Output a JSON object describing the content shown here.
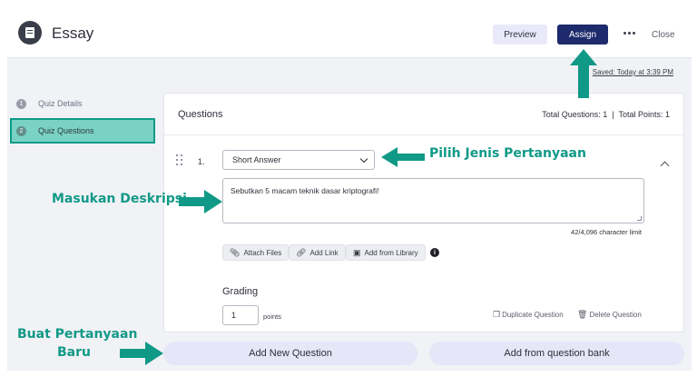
{
  "header": {
    "title": "Essay",
    "preview_label": "Preview",
    "assign_label": "Assign",
    "close_label": "Close",
    "saved_text": "Saved: Today at 3:39 PM"
  },
  "sidebar": {
    "items": [
      {
        "num": "1",
        "label": "Quiz Details",
        "active": false
      },
      {
        "num": "2",
        "label": "Quiz Questions",
        "active": true
      }
    ]
  },
  "questions": {
    "title": "Questions",
    "stats": "Total Questions: 1  |  Total Points: 1",
    "question_number": "1.",
    "type_selected": "Short Answer",
    "description": "Sebutkan 5 macam teknik dasar kriptografi!",
    "char_limit": "42/4,096 character limit",
    "attach_files": "Attach Files",
    "add_link": "Add Link",
    "add_from_library": "Add from Library",
    "info_glyph": "i",
    "grading_label": "Grading",
    "points_value": "1",
    "points_label": "points",
    "duplicate_label": "Duplicate Question",
    "delete_label": "Delete Question"
  },
  "bottom": {
    "add_new": "Add New Question",
    "add_bank": "Add from question bank"
  },
  "annotations": {
    "pilih": "Pilih Jenis Pertanyaan",
    "masukan": "Masukan Deskripsi",
    "buat_line1": "Buat Pertanyaan",
    "buat_line2": "Baru"
  },
  "colors": {
    "accent": "#1d2a6b",
    "annotation": "#119987",
    "active_sidebar": "#7ad2c4"
  }
}
